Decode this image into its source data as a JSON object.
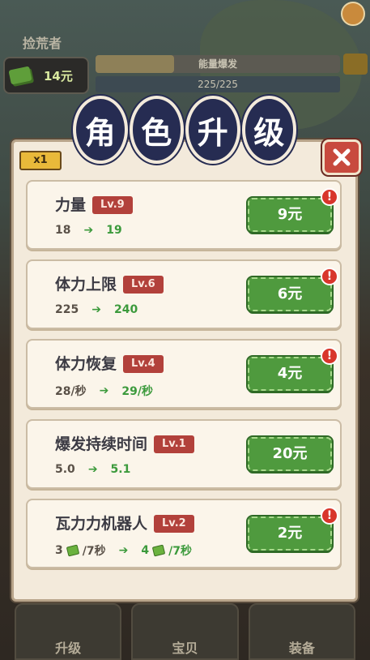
{
  "background": {
    "title": "捡荒者",
    "money": "14元",
    "energy_label": "能量爆发",
    "energy_value": "225/225",
    "nav_tabs": [
      "升级",
      "宝贝",
      "装备"
    ]
  },
  "modal": {
    "title_chars": [
      "角",
      "色",
      "升",
      "级"
    ],
    "multiplier": "x1",
    "close_icon": "close-x-icon",
    "items": [
      {
        "name": "力量",
        "level": "Lv.9",
        "current": "18",
        "next": "19",
        "price": "9元",
        "alert": true
      },
      {
        "name": "体力上限",
        "level": "Lv.6",
        "current": "225",
        "next": "240",
        "price": "6元",
        "alert": true
      },
      {
        "name": "体力恢复",
        "level": "Lv.4",
        "current": "28/秒",
        "next": "29/秒",
        "price": "4元",
        "alert": true
      },
      {
        "name": "爆发持续时间",
        "level": "Lv.1",
        "current": "5.0",
        "next": "5.1",
        "price": "20元",
        "alert": false
      },
      {
        "name": "瓦力力机器人",
        "level": "Lv.2",
        "current_prefix": "3",
        "current_suffix": "/7秒",
        "next_prefix": "4",
        "next_suffix": "/7秒",
        "price": "2元",
        "alert": true
      }
    ]
  },
  "colors": {
    "title_bg": "#262c52",
    "level_badge": "#b2413b",
    "price_button": "#4f9a3e",
    "stat_green": "#3c9a3c",
    "alert_red": "#d8352b"
  }
}
